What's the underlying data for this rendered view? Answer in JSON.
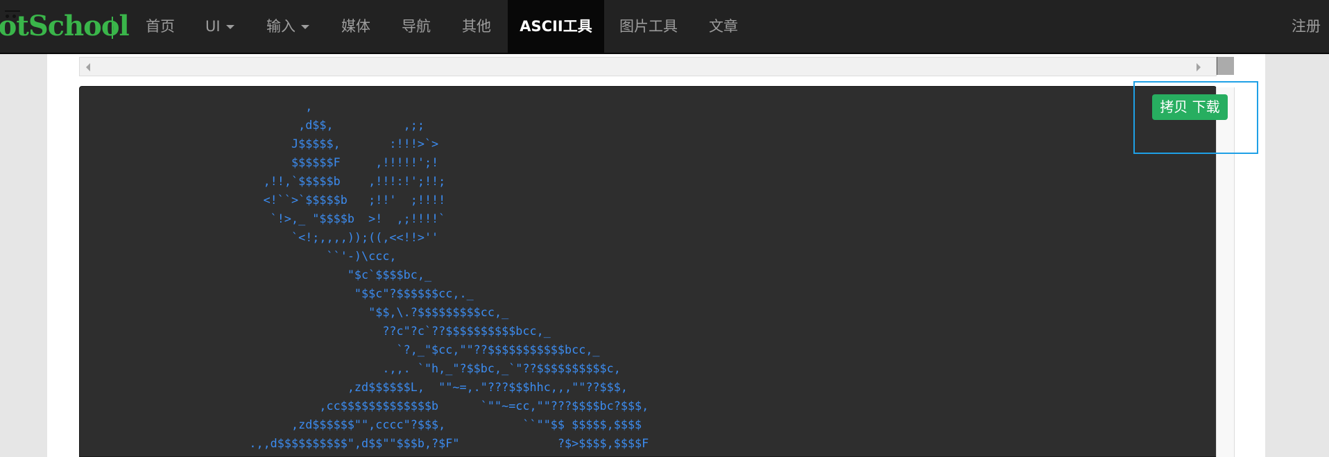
{
  "navbar": {
    "brand": "ootSchool",
    "items": [
      {
        "label": "首页",
        "dropdown": false
      },
      {
        "label": "UI",
        "dropdown": true
      },
      {
        "label": "输入",
        "dropdown": true
      },
      {
        "label": "媒体",
        "dropdown": false
      },
      {
        "label": "导航",
        "dropdown": false
      },
      {
        "label": "其他",
        "dropdown": false
      },
      {
        "label": "ASCII工具",
        "dropdown": false,
        "active": true
      },
      {
        "label": "图片工具",
        "dropdown": false
      },
      {
        "label": "文章",
        "dropdown": false
      }
    ],
    "register": "注册"
  },
  "tool": {
    "copy_download_label": "拷贝 下载",
    "ascii_lines": [
      "                               ,",
      "                              ,d$$,          ,;;",
      "                             J$$$$$,       :!!!>`>",
      "                             $$$$$$F     ,!!!!!';!",
      "                         ,!!,`$$$$$b    ,!!!:!';!!;",
      "                         <!``>`$$$$$b   ;!!'  ;!!!!",
      "                          `!>,_ \"$$$$b  >!  ,;!!!!`",
      "                             `<!;,,,,));((,<<!!>''",
      "                                  ``'-)\\ccc,",
      "                                     \"$c`$$$$bc,_",
      "                                      \"$$c\"?$$$$$$cc,._",
      "                                        \"$$,\\.?$$$$$$$$$cc,_",
      "                                          ??c\"?c`??$$$$$$$$$$bcc,_",
      "                                            `?,_\"$cc,\"\"??$$$$$$$$$$$bcc,_",
      "                                          .,,. `\"h,_\"?$$bc,_`\"??$$$$$$$$$$c,",
      "                                     ,zd$$$$$$L,  \"\"~=,.\"???$$$hhc,,,\"\"??$$$,",
      "                                 ,cc$$$$$$$$$$$$$b      `\"\"~=cc,\"\"???$$$$bc?$$$,",
      "                             ,zd$$$$$$\"\",cccc\"?$$$,           ``\"\"$$ $$$$$,$$$$",
      "                       .,,d$$$$$$$$$$\",d$$\"\"$$$b,?$F\"              ?$>$$$$,$$$$F"
    ]
  }
}
